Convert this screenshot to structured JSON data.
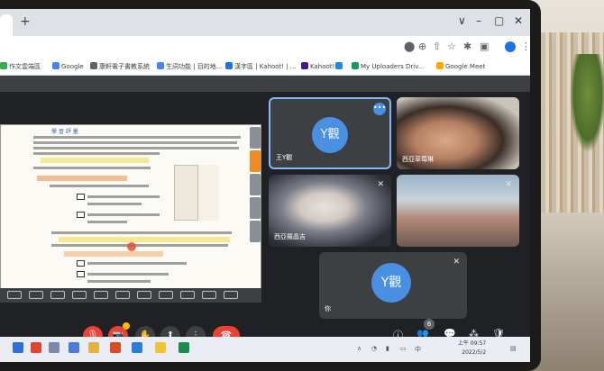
{
  "browser": {
    "new_tab": "+",
    "window_controls": [
      "∨",
      "–",
      "▢",
      "✕"
    ],
    "toolbar_icons": [
      "download-icon",
      "zoom-icon",
      "share-icon",
      "bookmark-star-icon",
      "extensions-icon",
      "sidebar-icon",
      "profile-icon"
    ],
    "menu": "⋮"
  },
  "bookmarks": [
    {
      "label": "作文雲端區",
      "color": "#34a853"
    },
    {
      "label": "Google",
      "color": "#4285f4"
    },
    {
      "label": "康軒電子書教系統",
      "color": "#5f6368"
    },
    {
      "label": "生詞功能 | 目的地...",
      "color": "#4285f4"
    },
    {
      "label": "漢字區 | Kahoot! | ...",
      "color": "#1a73e8"
    },
    {
      "label": "Kahoot!",
      "color": "#46178f"
    },
    {
      "label": "",
      "color": "#1e88e5"
    },
    {
      "label": "My Uploaders Driv...",
      "color": "#0f9d58"
    },
    {
      "label": "Google Meet",
      "color": "#f9ab00"
    }
  ],
  "presentation": {
    "worksheet_title": "學 習 評 量",
    "side_tabs": [
      "",
      "",
      "",
      "",
      ""
    ]
  },
  "participants": [
    {
      "name": "王Y觀",
      "initials": "Y觀",
      "tile": "t1"
    },
    {
      "name": "西亞草莓琳",
      "tile": "t2"
    },
    {
      "name": "西亞羅晶吉",
      "tile": "t3"
    },
    {
      "name": "",
      "tile": "t4"
    },
    {
      "name": "你",
      "initials": "Y觀",
      "tile": "t5"
    }
  ],
  "controls": {
    "mic": "🎙",
    "camera": "📷",
    "raise_hand": "✋",
    "present": "⬆",
    "more": "⋮",
    "end_call": "☎",
    "info": "ⓘ",
    "people": "👥",
    "people_count": "6",
    "chat": "💬",
    "activities": "⁂",
    "safety": "🛡"
  },
  "taskbar": {
    "time": "上午 09:57",
    "date": "2022/5/2"
  },
  "colors": {
    "accent": "#4a90e2",
    "end_call": "#ea4335",
    "meet_bg": "#202124"
  }
}
